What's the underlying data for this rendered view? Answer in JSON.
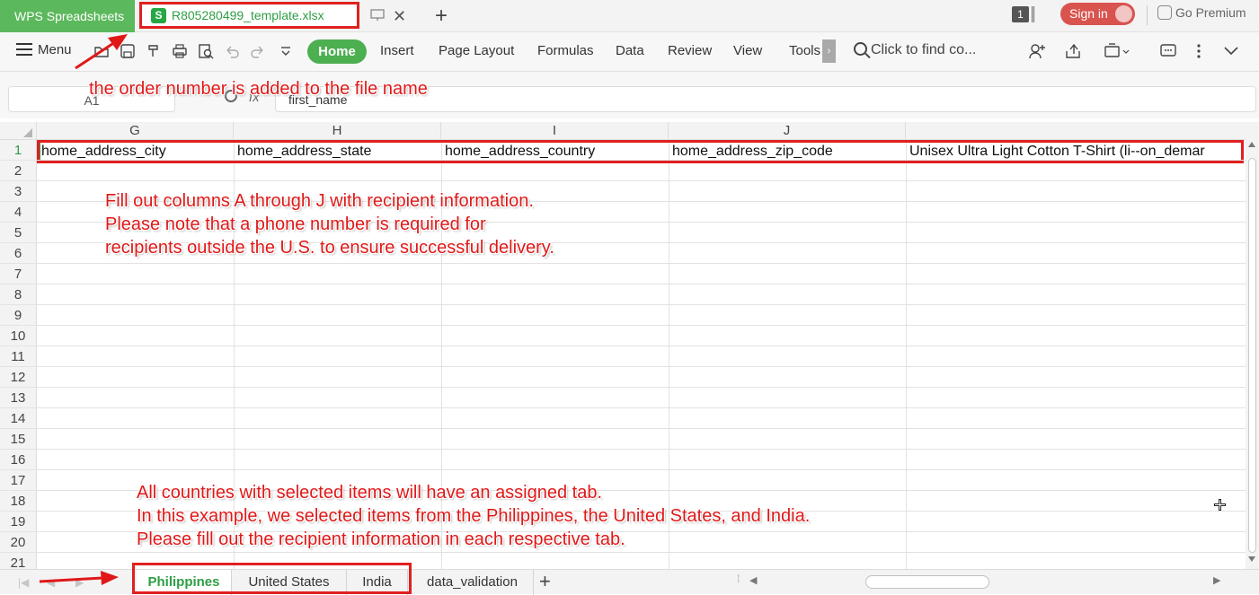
{
  "titlebar": {
    "app_name": "WPS Spreadsheets",
    "doc_tab_name": "R805280499_template.xlsx",
    "window_count": "1",
    "signin_label": "Sign in",
    "premium_label": "Go Premium"
  },
  "ribbon": {
    "menu_label": "Menu",
    "tabs": [
      "Home",
      "Insert",
      "Page Layout",
      "Formulas",
      "Data",
      "Review",
      "View",
      "Tools"
    ],
    "tools_overflow": "›",
    "find_placeholder": "Click to find co..."
  },
  "formula_bar": {
    "name_box": "A1",
    "fx": "fx",
    "formula": "first_name"
  },
  "grid": {
    "columns": [
      "G",
      "H",
      "I",
      "J"
    ],
    "rows": [
      "1",
      "2",
      "3",
      "4",
      "5",
      "6",
      "7",
      "8",
      "9",
      "10",
      "11",
      "12",
      "13",
      "14",
      "15",
      "16",
      "17",
      "18",
      "19",
      "20",
      "21"
    ],
    "row1": [
      "home_address_city",
      "home_address_state",
      "home_address_country",
      "home_address_zip_code",
      "Unisex Ultra Light Cotton T-Shirt (li--on_demar"
    ]
  },
  "sheets": {
    "tabs": [
      "Philippines",
      "United States",
      "India",
      "data_validation"
    ],
    "active": "Philippines",
    "add_label": "+"
  },
  "annotations": {
    "filename_note": "the order number is added to the file name",
    "fill_note": [
      "Fill out columns A through J with recipient information.",
      "Please note that a phone number is required for",
      "recipients outside the U.S. to ensure successful delivery."
    ],
    "tabs_note": [
      "All countries with selected items will have an assigned tab.",
      "In this example, we selected items from the Philippines, the United States, and India.",
      "Please fill out the recipient information in each respective tab."
    ]
  },
  "colors": {
    "annotation_red": "#e01818",
    "wps_green": "#4caf50",
    "signin_red": "#d9534f"
  }
}
